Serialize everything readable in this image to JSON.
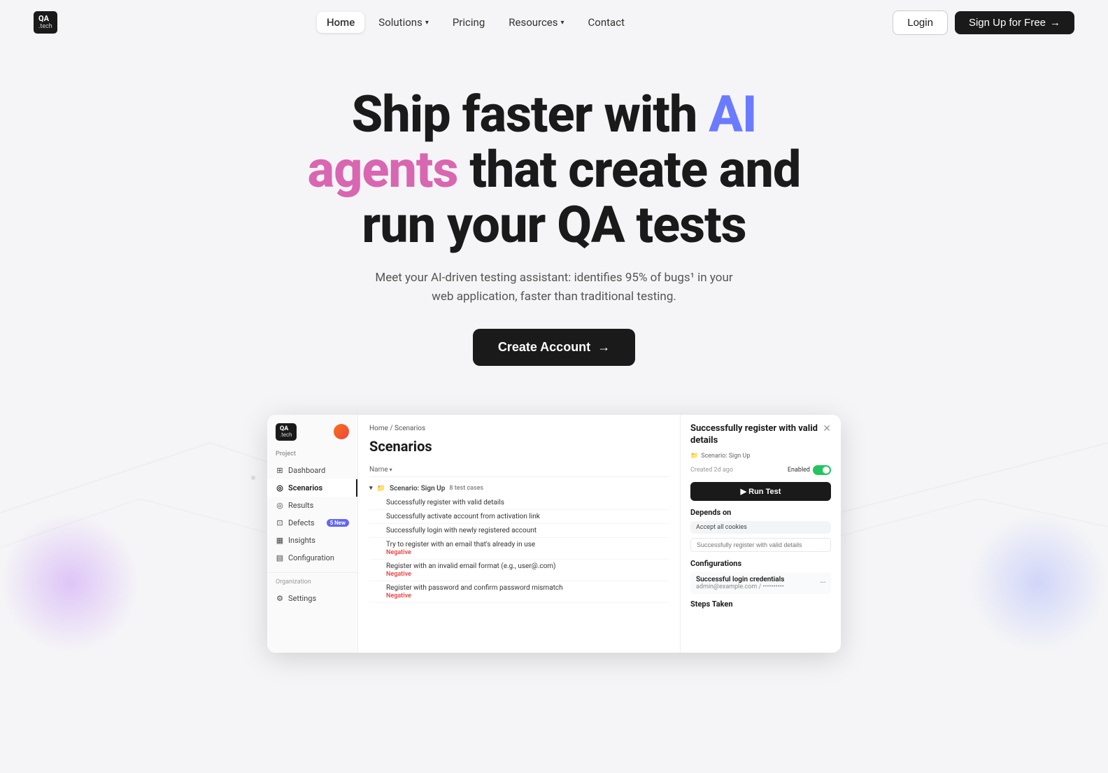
{
  "nav": {
    "logo": {
      "qa": "QA",
      "dot": ".",
      "tech": "tech"
    },
    "items": [
      {
        "label": "Home",
        "active": true
      },
      {
        "label": "Solutions",
        "hasChevron": true
      },
      {
        "label": "Pricing"
      },
      {
        "label": "Resources",
        "hasChevron": true
      },
      {
        "label": "Contact"
      }
    ],
    "login_label": "Login",
    "signup_label": "Sign Up for Free",
    "signup_arrow": "→"
  },
  "hero": {
    "headline_1": "Ship faster with ",
    "ai": "AI",
    "headline_2": "agents",
    "headline_3": " that create and",
    "headline_4": "run your QA tests",
    "subtext": "Meet your AI-driven testing assistant: identifies 95% of bugs¹ in your web application, faster than traditional testing.",
    "cta_label": "Create Account",
    "cta_arrow": "→"
  },
  "mockup": {
    "breadcrumb_home": "Home",
    "breadcrumb_sep": "/",
    "breadcrumb_page": "Scenarios",
    "page_title": "Scenarios",
    "table_col": "Name",
    "scenario_name": "Scenario: Sign Up",
    "scenario_test_count": "8 test cases",
    "test_items": [
      {
        "label": "Successfully register with valid details",
        "negative": false
      },
      {
        "label": "Successfully activate account from activation link",
        "negative": false
      },
      {
        "label": "Successfully login with newly registered account",
        "negative": false
      },
      {
        "label": "Try to register with an email that's already in use",
        "negative": true
      },
      {
        "label": "Register with an invalid email format (e.g., user@.com)",
        "negative": true
      },
      {
        "label": "Register with password and confirm password mismatch",
        "negative": true
      }
    ],
    "negative_label": "Negative",
    "sidebar": {
      "project_label": "Project",
      "items": [
        {
          "label": "Dashboard",
          "icon": "□"
        },
        {
          "label": "Scenarios",
          "icon": "◎",
          "active": true
        },
        {
          "label": "Results",
          "icon": "◎"
        },
        {
          "label": "Defects",
          "icon": "□",
          "badge": "5 New"
        },
        {
          "label": "Insights",
          "icon": "▦"
        },
        {
          "label": "Configuration",
          "icon": "▦"
        }
      ],
      "org_label": "Organization",
      "org_items": [
        {
          "label": "Settings",
          "icon": "⚙"
        }
      ]
    },
    "panel": {
      "title": "Successfully register with valid details",
      "scenario_tag": "Scenario: Sign Up",
      "created": "Created 2d ago",
      "enabled_label": "Enabled",
      "run_test_label": "▶ Run Test",
      "depends_on_title": "Depends on",
      "depends_chip": "Accept all cookies",
      "depends_placeholder": "Successfully register with valid details",
      "configurations_title": "Configurations",
      "config_title": "Successful login credentials",
      "config_subtitle": "admin@example.com / ••••••••••",
      "steps_title": "Steps Taken",
      "close_icon": "✕"
    }
  }
}
